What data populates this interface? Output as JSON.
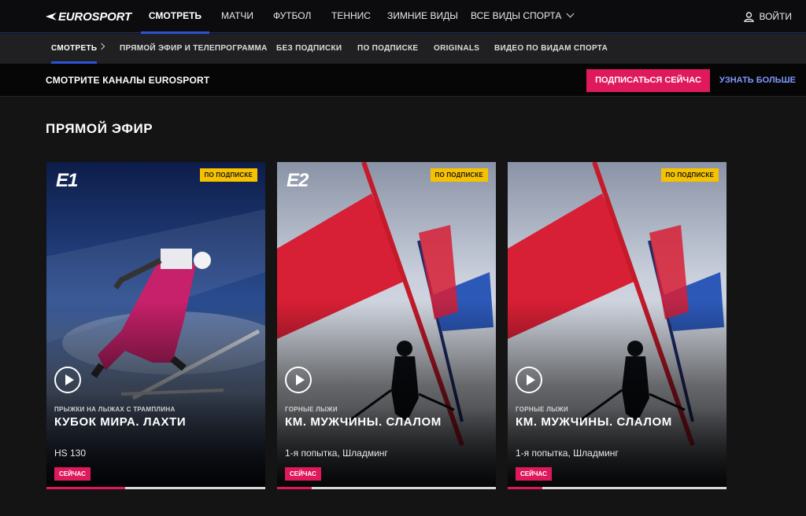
{
  "brand": {
    "logo_text": "EUROSPORT"
  },
  "topnav": {
    "items": [
      "СМОТРЕТЬ",
      "МАТЧИ",
      "ФУТБОЛ",
      "ТЕННИС",
      "ЗИМНИЕ ВИДЫ",
      "ВСЕ ВИДЫ СПОРТА"
    ],
    "login": "ВОЙТИ"
  },
  "subnav": {
    "items": [
      "СМОТРЕТЬ",
      "ПРЯМОЙ ЭФИР И ТЕЛЕПРОГРАММА",
      "БЕЗ ПОДПИСКИ",
      "ПО ПОДПИСКЕ",
      "ORIGINALS",
      "ВИДЕО ПО ВИДАМ СПОРТА"
    ]
  },
  "promo": {
    "text": "СМОТРИТЕ КАНАЛЫ EUROSPORT",
    "subscribe": "ПОДПИСАТЬСЯ СЕЙЧАС",
    "more": "УЗНАТЬ БОЛЬШЕ"
  },
  "section": {
    "title": "ПРЯМОЙ ЭФИР"
  },
  "cards": [
    {
      "channel": "E1",
      "badge": "ПО ПОДПИСКЕ",
      "sport": "ПРЫЖКИ НА ЛЫЖАХ С ТРАМПЛИНА",
      "event": "КУБОК МИРА. ЛАХТИ",
      "detail": "HS 130",
      "status": "СЕЙЧАС",
      "progress": 0.36
    },
    {
      "channel": "E2",
      "badge": "ПО ПОДПИСКЕ",
      "sport": "ГОРНЫЕ ЛЫЖИ",
      "event": "КМ. МУЖЧИНЫ. СЛАЛОМ",
      "detail": "1-я попытка, Шладминг",
      "status": "СЕЙЧАС",
      "progress": 0.16
    },
    {
      "channel": "",
      "badge": "ПО ПОДПИСКЕ",
      "sport": "ГОРНЫЕ ЛЫЖИ",
      "event": "КМ. МУЖЧИНЫ. СЛАЛОМ",
      "detail": "1-я попытка, Шладминг",
      "status": "СЕЙЧАС",
      "progress": 0.16
    }
  ],
  "colors": {
    "accent_pink": "#e0185c",
    "accent_blue": "#2a53d8",
    "badge_yellow": "#f6c200",
    "link_blue": "#7e99ff"
  }
}
